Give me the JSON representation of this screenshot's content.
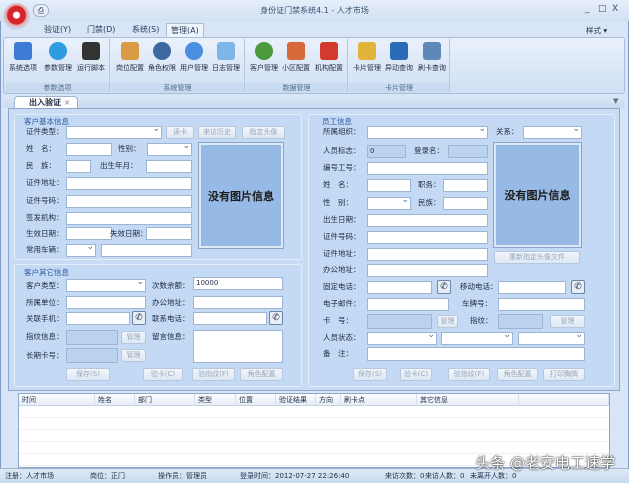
{
  "window": {
    "title": "身份证门禁系统4.1 - 人才市场",
    "min": "_",
    "max": "□",
    "close": "X",
    "style_menu": "样式 ▾"
  },
  "quick_access": "⎙",
  "ribbon_tabs": [
    "验证(Y)",
    "门禁(D)",
    "系统(S)",
    "管理(A)"
  ],
  "ribbon_groups": [
    {
      "label": "参数选项",
      "items": [
        "系统选项",
        "参数管理",
        "运行脚本"
      ]
    },
    {
      "label": "系统管理",
      "items": [
        "岗位配置",
        "角色权限",
        "用户管理",
        "日志管理"
      ]
    },
    {
      "label": "数据管理",
      "items": [
        "客户管理",
        "小区配置",
        "机构配置"
      ]
    },
    {
      "label": "卡片管理",
      "items": [
        "卡片管理",
        "异动查询",
        "刷卡查询"
      ]
    }
  ],
  "doc_tab": {
    "label": "出入验证",
    "close": "×"
  },
  "customer_basic": {
    "title": "客户基本信息",
    "id_type": "证件类型：",
    "read_card": "读卡",
    "visit_history": "来访历史",
    "set_avatar": "指定头像",
    "name": "姓　名：",
    "gender": "性别：",
    "ethnicity": "民　族：",
    "birth": "出生年月：",
    "id_address": "证件地址：",
    "id_number": "证件号码：",
    "issuer": "签发机构：",
    "valid_from": "生效日期：",
    "valid_to": "失效日期：",
    "vehicle": "常用车辆：",
    "no_photo": "没有图片信息"
  },
  "customer_other": {
    "title": "客户其它信息",
    "type": "客户类型：",
    "remaining": "次数余额：",
    "remaining_value": "10000",
    "company": "所属单位：",
    "office": "办公地址：",
    "mobile": "关联手机：",
    "phone": "联系电话：",
    "fingerprint": "指纹信息：",
    "manage": "管理",
    "message": "留言信息：",
    "long_card": "长期卡号：",
    "save": "保存(S)",
    "verify_card": "验卡(C)",
    "verify_fp": "验指纹(F)",
    "role": "角色配置"
  },
  "employee": {
    "title": "员工信息",
    "org": "所属组织：",
    "relation": "关系：",
    "flag": "人员标志：",
    "flag_value": "0",
    "login": "登录名：",
    "emp_no": "编号工号：",
    "name": "姓　名：",
    "position": "职务：",
    "gender": "性　别：",
    "ethnicity": "民族：",
    "birth": "出生日期：",
    "id_number": "证件号码：",
    "id_address": "证件地址：",
    "office": "办公地址：",
    "landline": "固定电话：",
    "mobile": "移动电话：",
    "email": "电子邮件：",
    "plate": "车牌号：",
    "card": "卡　号：",
    "manage": "管理",
    "fingerprint": "指纹：",
    "status": "人员状态：",
    "remark": "备　注：",
    "no_photo": "没有图片信息",
    "reset_avatar": "重新指定头像文件",
    "save": "保存(S)",
    "verify_card": "验卡(C)",
    "verify_fp": "验指纹(F)",
    "role": "角色配置",
    "print_badge": "打印胸牌"
  },
  "log_table": {
    "columns": [
      "时间",
      "姓名",
      "部门",
      "类型",
      "位置",
      "验证结果",
      "方向",
      "刷卡点",
      "其它信息"
    ],
    "rows": []
  },
  "status_bar": {
    "register": "注册：人才市场",
    "post": "岗位：正门",
    "operator": "操作员：管理员",
    "login_time": "登录时间：2012-07-27 22:26:40",
    "visits": "来访次数：0",
    "visitors": "来访人数：0",
    "not_left": "未离开人数：0"
  },
  "watermark": "头条 @老安电工速学"
}
